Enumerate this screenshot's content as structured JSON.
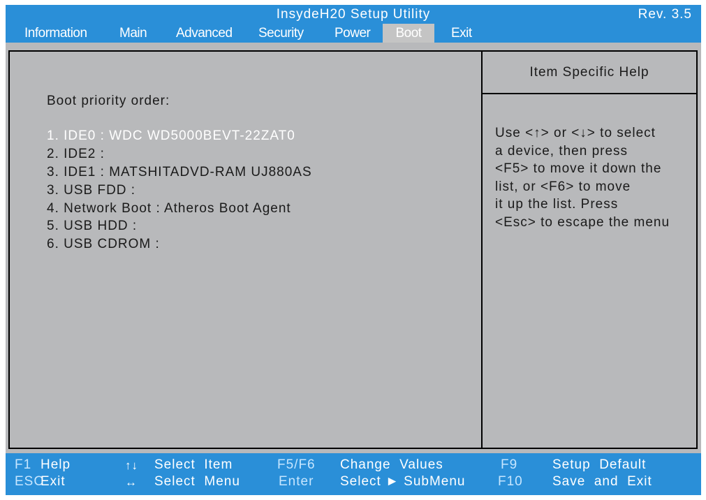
{
  "title_bar": {
    "title": "InsydeH20 Setup Utility",
    "revision": "Rev. 3.5"
  },
  "menu": {
    "items": [
      {
        "label": "Information"
      },
      {
        "label": "Main"
      },
      {
        "label": "Advanced"
      },
      {
        "label": "Security"
      },
      {
        "label": "Power"
      },
      {
        "label": "Boot"
      },
      {
        "label": "Exit"
      }
    ],
    "active": "Boot"
  },
  "boot": {
    "heading": "Boot priority order:",
    "items": [
      {
        "label": "1. IDE0 : WDC WD5000BEVT-22ZAT0"
      },
      {
        "label": "2. IDE2 :"
      },
      {
        "label": "3. IDE1 : MATSHITADVD-RAM UJ880AS"
      },
      {
        "label": "3. USB FDD :"
      },
      {
        "label": "4. Network Boot : Atheros Boot Agent"
      },
      {
        "label": "5. USB HDD :"
      },
      {
        "label": "6. USB CDROM :"
      }
    ],
    "selected_index": 0
  },
  "help": {
    "title": "Item Specific Help",
    "lines": [
      "Use <↑> or <↓> to select",
      "a device, then press",
      "<F5> to move it down the",
      "list, or <F6> to move",
      "it up the list. Press",
      "<Esc> to escape the menu"
    ]
  },
  "keys": {
    "f1": {
      "key": "F1",
      "desc": "Help"
    },
    "esc": {
      "key": "ESC",
      "desc": "Exit"
    },
    "updown": {
      "key": "↑↓",
      "desc": "Select  Item"
    },
    "leftright": {
      "key": "↔",
      "desc": "Select  Menu"
    },
    "f5f6": {
      "key": "F5/F6",
      "desc": "Change  Values"
    },
    "enter": {
      "key": "Enter",
      "desc": "Select ► SubMenu"
    },
    "f9": {
      "key": "F9",
      "desc": "Setup  Default"
    },
    "f10": {
      "key": "F10",
      "desc": "Save  and  Exit"
    }
  },
  "colors": {
    "bar_blue": "#2a8fd8",
    "panel_gray": "#b8b9bb",
    "active_tab": "#c4c4c4",
    "key_name": "#c6e6ff"
  }
}
